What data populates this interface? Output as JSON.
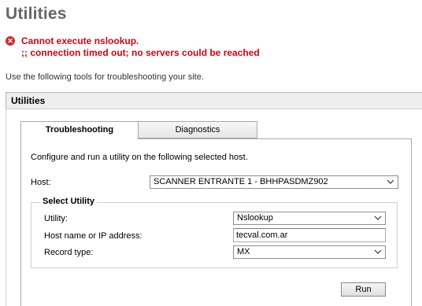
{
  "page": {
    "title": "Utilities"
  },
  "error": {
    "icon": "error-x-icon",
    "line1": "Cannot execute nslookup.",
    "line2": ";; connection timed out; no servers could be reached",
    "color": "#d8000c"
  },
  "intro": "Use the following tools for troubleshooting your site.",
  "section": {
    "title": "Utilities"
  },
  "tabs": [
    {
      "label": "Troubleshooting",
      "active": true
    },
    {
      "label": "Diagnostics",
      "active": false
    }
  ],
  "panel": {
    "description": "Configure and run a utility on the following selected host.",
    "host_label": "Host:",
    "host_value": "SCANNER ENTRANTE 1 - BHHPASDMZ902",
    "select_utility": {
      "legend": "Select Utility",
      "utility_label": "Utility:",
      "utility_value": "Nslookup",
      "hostname_label": "Host name or IP address:",
      "hostname_value": "tecval.com.ar",
      "record_label": "Record type:",
      "record_value": "MX"
    },
    "run_label": "Run"
  }
}
